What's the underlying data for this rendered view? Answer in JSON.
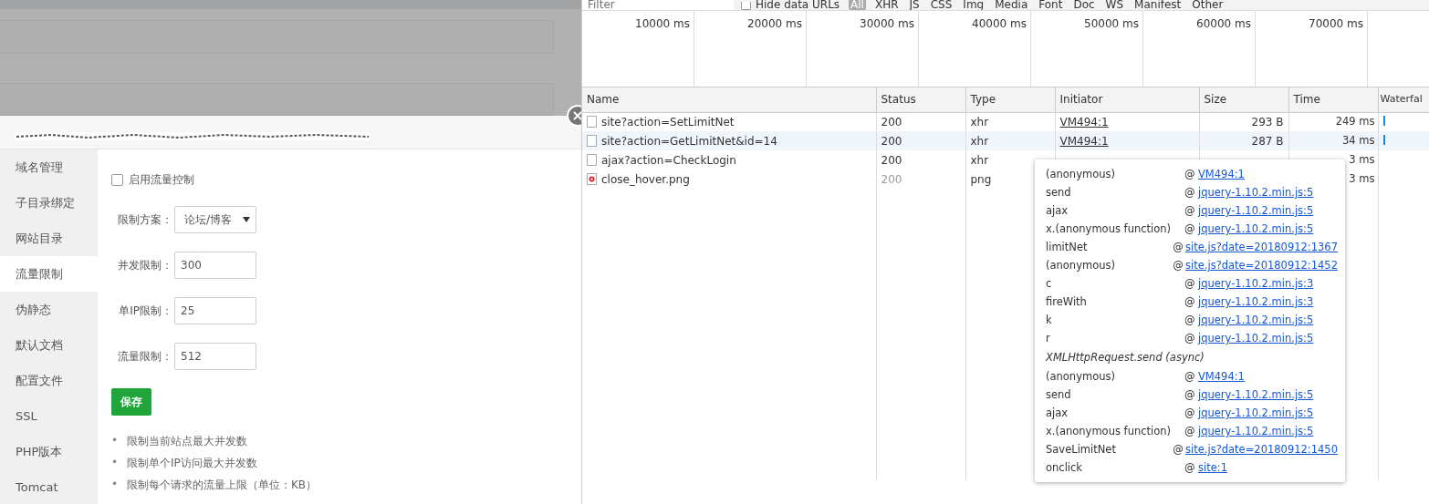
{
  "dialog": {
    "sidebar": [
      {
        "label": "域名管理",
        "selected": false
      },
      {
        "label": "子目录绑定",
        "selected": false
      },
      {
        "label": "网站目录",
        "selected": false
      },
      {
        "label": "流量限制",
        "selected": true
      },
      {
        "label": "伪静态",
        "selected": false
      },
      {
        "label": "默认文档",
        "selected": false
      },
      {
        "label": "配置文件",
        "selected": false
      },
      {
        "label": "SSL",
        "selected": false
      },
      {
        "label": "PHP版本",
        "selected": false
      },
      {
        "label": "Tomcat",
        "selected": false
      }
    ],
    "enable": {
      "label": "启用流量控制",
      "checked": false
    },
    "scheme": {
      "label": "限制方案：",
      "value": "论坛/博客"
    },
    "fields": [
      {
        "label": "并发限制：",
        "value": "300"
      },
      {
        "label": "单IP限制：",
        "value": "25"
      },
      {
        "label": "流量限制：",
        "value": "512"
      }
    ],
    "save_button": "保存",
    "notes": [
      {
        "bullet": "•",
        "text": "限制当前站点最大并发数"
      },
      {
        "bullet": "•",
        "text": "限制单个IP访问最大并发数"
      },
      {
        "bullet": "•",
        "text": "限制每个请求的流量上限（单位：KB）"
      }
    ]
  },
  "devtools": {
    "filter": {
      "placeholder": "Filter"
    },
    "hide_data_urls": {
      "label": "Hide data URLs",
      "checked": false
    },
    "type_filters": [
      {
        "label": "All",
        "selected": true
      },
      {
        "label": "XHR",
        "selected": false
      },
      {
        "label": "JS",
        "selected": false
      },
      {
        "label": "CSS",
        "selected": false
      },
      {
        "label": "Img",
        "selected": false
      },
      {
        "label": "Media",
        "selected": false
      },
      {
        "label": "Font",
        "selected": false
      },
      {
        "label": "Doc",
        "selected": false
      },
      {
        "label": "WS",
        "selected": false
      },
      {
        "label": "Manifest",
        "selected": false
      },
      {
        "label": "Other",
        "selected": false
      }
    ],
    "timeline_ticks": [
      "10000 ms",
      "20000 ms",
      "30000 ms",
      "40000 ms",
      "50000 ms",
      "60000 ms",
      "70000 ms"
    ],
    "table": {
      "columns": [
        "Name",
        "Status",
        "Type",
        "Initiator",
        "Size",
        "Time",
        "Waterfal"
      ],
      "rows": [
        {
          "kind": "document",
          "name": "site?action=SetLimitNet",
          "status": "200",
          "status_dimmed": false,
          "type": "xhr",
          "initiator": "VM494:1",
          "size": "293 B",
          "time": "249 ms",
          "waterfall_bar": true,
          "selected": false
        },
        {
          "kind": "document",
          "name": "site?action=GetLimitNet&id=14",
          "status": "200",
          "status_dimmed": false,
          "type": "xhr",
          "initiator": "VM494:1",
          "size": "287 B",
          "time": "34 ms",
          "waterfall_bar": true,
          "selected": true
        },
        {
          "kind": "document",
          "name": "ajax?action=CheckLogin",
          "status": "200",
          "status_dimmed": false,
          "type": "xhr",
          "time": "3 ms",
          "waterfall_bar": false,
          "selected": false
        },
        {
          "kind": "image",
          "name": "close_hover.png",
          "status": "200",
          "status_dimmed": true,
          "type": "png",
          "time": "3 ms",
          "waterfall_bar": false,
          "selected": false
        }
      ]
    },
    "initiator_popup": [
      {
        "kind": "frame",
        "function": "(anonymous)",
        "at_sign": "@",
        "location": "VM494:1"
      },
      {
        "kind": "frame",
        "function": "send",
        "at_sign": "@",
        "location": "jquery-1.10.2.min.js:5"
      },
      {
        "kind": "frame",
        "function": "ajax",
        "at_sign": "@",
        "location": "jquery-1.10.2.min.js:5"
      },
      {
        "kind": "frame",
        "function": "x.(anonymous function)",
        "at_sign": "@",
        "location": "jquery-1.10.2.min.js:5"
      },
      {
        "kind": "frame",
        "function": "limitNet",
        "at_sign": "@",
        "location": "site.js?date=20180912:1367"
      },
      {
        "kind": "frame",
        "function": "(anonymous)",
        "at_sign": "@",
        "location": "site.js?date=20180912:1452"
      },
      {
        "kind": "frame",
        "function": "c",
        "at_sign": "@",
        "location": "jquery-1.10.2.min.js:3"
      },
      {
        "kind": "frame",
        "function": "fireWith",
        "at_sign": "@",
        "location": "jquery-1.10.2.min.js:3"
      },
      {
        "kind": "frame",
        "function": "k",
        "at_sign": "@",
        "location": "jquery-1.10.2.min.js:5"
      },
      {
        "kind": "frame",
        "function": "r",
        "at_sign": "@",
        "location": "jquery-1.10.2.min.js:5"
      },
      {
        "kind": "async",
        "function": "XMLHttpRequest.send (async)"
      },
      {
        "kind": "frame",
        "function": "(anonymous)",
        "at_sign": "@",
        "location": "VM494:1"
      },
      {
        "kind": "frame",
        "function": "send",
        "at_sign": "@",
        "location": "jquery-1.10.2.min.js:5"
      },
      {
        "kind": "frame",
        "function": "ajax",
        "at_sign": "@",
        "location": "jquery-1.10.2.min.js:5"
      },
      {
        "kind": "frame",
        "function": "x.(anonymous function)",
        "at_sign": "@",
        "location": "jquery-1.10.2.min.js:5"
      },
      {
        "kind": "frame",
        "function": "SaveLimitNet",
        "at_sign": "@",
        "location": "site.js?date=20180912:1450"
      },
      {
        "kind": "frame",
        "function": "onclick",
        "at_sign": "@",
        "location": "site:1"
      }
    ]
  }
}
